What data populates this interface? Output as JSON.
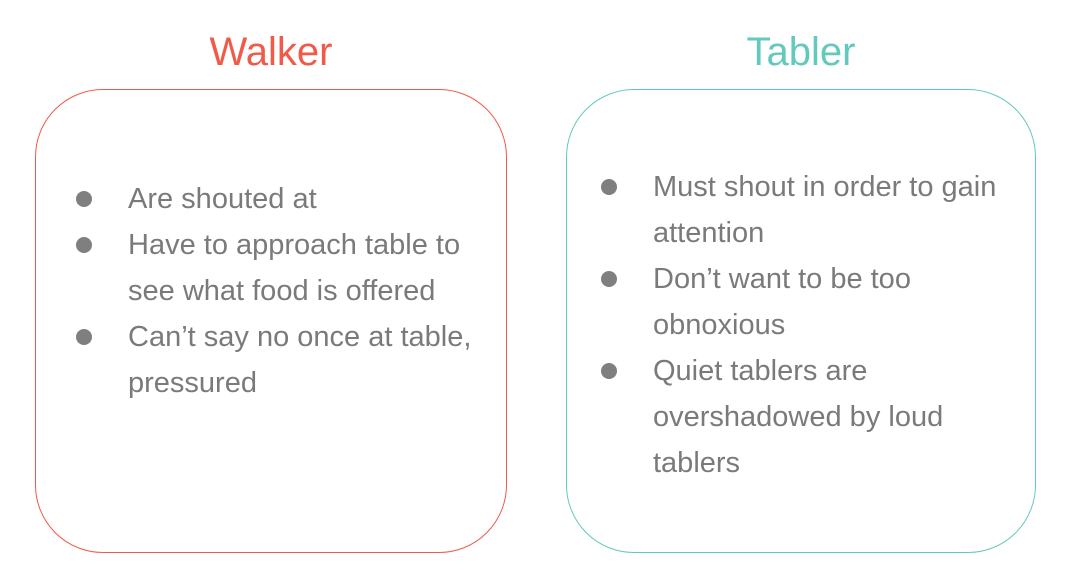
{
  "walker": {
    "title": "Walker",
    "color": "#f05a48",
    "items": [
      "Are shouted at",
      "Have to approach table to see what food is offered",
      "Can’t say no once at table, pressured"
    ]
  },
  "tabler": {
    "title": "Tabler",
    "color": "#64c9bd",
    "items": [
      "Must shout in order to gain attention",
      "Don’t want to be too obnoxious",
      "Quiet tablers are overshadowed by loud tablers"
    ]
  }
}
